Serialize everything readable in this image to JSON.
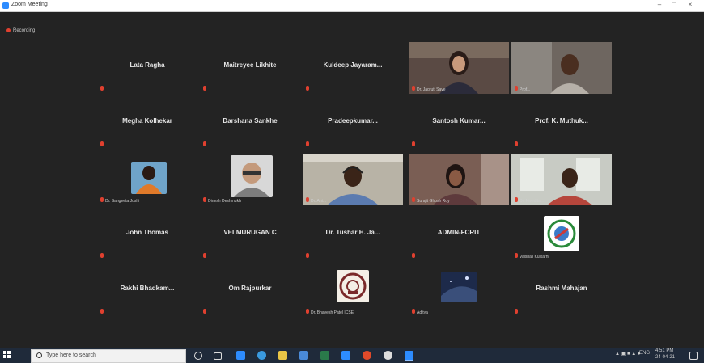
{
  "window": {
    "title": "Zoom Meeting"
  },
  "recording": {
    "label": "Recording"
  },
  "tiles": [
    {
      "name": "Lata Ragha",
      "label": ""
    },
    {
      "name": "Maitreyee Likhite",
      "label": ""
    },
    {
      "name": "Kuldeep Jayaram...",
      "label": ""
    },
    {
      "name": "",
      "label": "Dr. Jagruti Save"
    },
    {
      "name": "",
      "label": "Prof..."
    },
    {
      "name": "Megha Kolhekar",
      "label": ""
    },
    {
      "name": "Darshana Sankhe",
      "label": ""
    },
    {
      "name": "Pradeepkumar...",
      "label": ""
    },
    {
      "name": "Santosh Kumar...",
      "label": ""
    },
    {
      "name": "Prof. K. Muthuk...",
      "label": ""
    },
    {
      "name": "",
      "label": "Dr. Sangeeta Joshi"
    },
    {
      "name": "",
      "label": "Dinesh Deshmukh"
    },
    {
      "name": "",
      "label": "Dr. Ani..."
    },
    {
      "name": "",
      "label": "Surajit Ghosh Roy"
    },
    {
      "name": "",
      "label": "Dr. Nivedita..."
    },
    {
      "name": "John Thomas",
      "label": ""
    },
    {
      "name": "VELMURUGAN C",
      "label": ""
    },
    {
      "name": "Dr. Tushar H. Ja...",
      "label": ""
    },
    {
      "name": "ADMIN-FCRIT",
      "label": ""
    },
    {
      "name": "",
      "label": "Vaishali Kulkarni"
    },
    {
      "name": "Rakhi Bhadkam...",
      "label": ""
    },
    {
      "name": "Om Rajpurkar",
      "label": ""
    },
    {
      "name": "",
      "label": "Dr. Bhavesh Patel ICSE"
    },
    {
      "name": "",
      "label": "Aditya"
    },
    {
      "name": "Rashmi Mahajan",
      "label": ""
    }
  ],
  "taskbar": {
    "search_placeholder": "Type here to search",
    "time": "4:51 PM",
    "date": "24-04-21",
    "lang": "ENG"
  },
  "colors": {
    "active_speaker": "#c9d22b",
    "mic_muted": "#e0402f",
    "taskbar": "#1f2a3a"
  }
}
